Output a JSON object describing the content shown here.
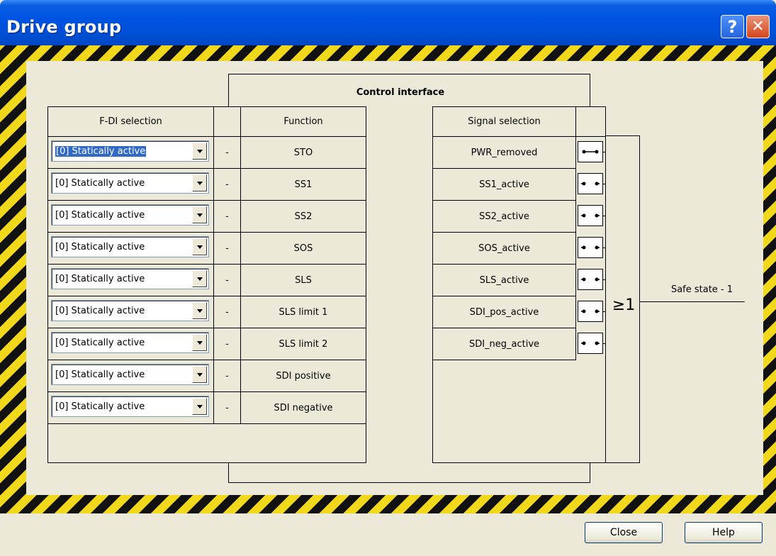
{
  "window": {
    "title": "Drive group",
    "help_glyph": "?",
    "close_glyph": "✕"
  },
  "control_interface": {
    "title": "Control interface"
  },
  "headers": {
    "fdi_selection": "F-DI selection",
    "function": "Function",
    "signal_selection": "Signal selection"
  },
  "rows": [
    {
      "fdi": "[0] Statically active",
      "dash": "-",
      "function": "STO"
    },
    {
      "fdi": "[0] Statically active",
      "dash": "-",
      "function": "SS1"
    },
    {
      "fdi": "[0] Statically active",
      "dash": "-",
      "function": "SS2"
    },
    {
      "fdi": "[0] Statically active",
      "dash": "-",
      "function": "SOS"
    },
    {
      "fdi": "[0] Statically active",
      "dash": "-",
      "function": "SLS"
    },
    {
      "fdi": "[0] Statically active",
      "dash": "-",
      "function": "SLS limit 1"
    },
    {
      "fdi": "[0] Statically active",
      "dash": "-",
      "function": "SLS limit 2"
    },
    {
      "fdi": "[0] Statically active",
      "dash": "-",
      "function": "SDI positive"
    },
    {
      "fdi": "[0] Statically active",
      "dash": "-",
      "function": "SDI negative"
    }
  ],
  "signals": [
    {
      "label": "PWR_removed",
      "switch_state": "closed"
    },
    {
      "label": "SS1_active",
      "switch_state": "open"
    },
    {
      "label": "SS2_active",
      "switch_state": "open"
    },
    {
      "label": "SOS_active",
      "switch_state": "open"
    },
    {
      "label": "SLS_active",
      "switch_state": "open"
    },
    {
      "label": "SDI_pos_active",
      "switch_state": "open"
    },
    {
      "label": "SDI_neg_active",
      "switch_state": "open"
    }
  ],
  "or_gate": {
    "symbol": "≥1"
  },
  "output": {
    "label": "Safe state - 1"
  },
  "buttons": {
    "close": "Close",
    "help": "Help"
  },
  "colors": {
    "title_bar": "#0054e3",
    "hazard_yellow": "#f2d81a",
    "hazard_black": "#111111",
    "dialog_bg": "#ece9d8",
    "selection": "#316ac5"
  }
}
